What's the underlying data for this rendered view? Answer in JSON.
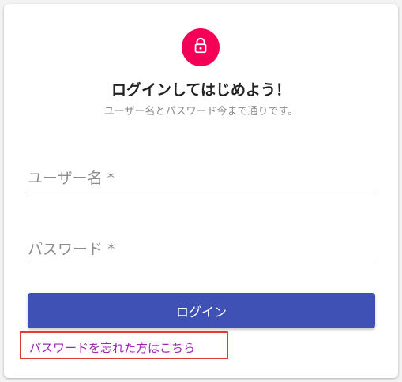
{
  "header": {
    "title": "ログインしてはじめよう！",
    "subtitle": "ユーザー名とパスワード今まで通りです。",
    "avatar_icon": "lock-icon",
    "avatar_color": "#f50057"
  },
  "form": {
    "username_label": "ユーザー名 *",
    "username_value": "",
    "password_label": "パスワード *",
    "password_value": ""
  },
  "actions": {
    "login_label": "ログイン",
    "login_color": "#3f51b5",
    "forgot_password_label": "パスワードを忘れた方はこちら",
    "forgot_password_color": "#9c27b0",
    "highlight_color": "#e53935"
  }
}
